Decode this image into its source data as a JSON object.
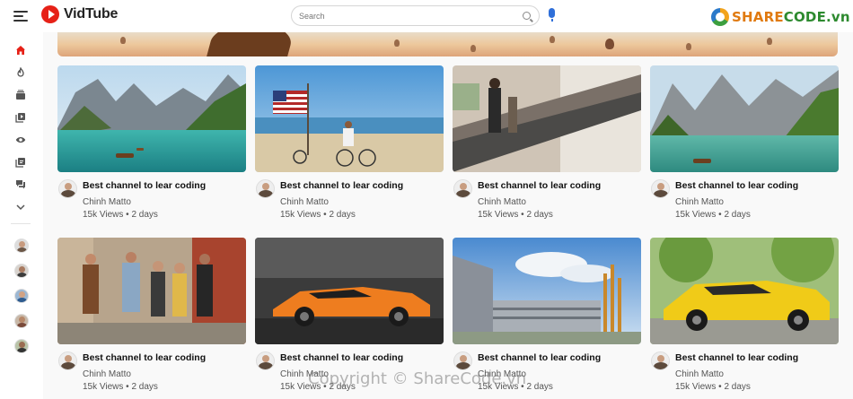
{
  "app": {
    "name": "VidTube"
  },
  "search": {
    "placeholder": "Search",
    "value": ""
  },
  "header": {
    "icons": [
      "upload-icon",
      "apps-icon",
      "bell-icon",
      "profile-avatar"
    ]
  },
  "sidebar": {
    "items": [
      {
        "icon": "home-icon",
        "color": "#e62117"
      },
      {
        "icon": "trending-icon"
      },
      {
        "icon": "subscriptions-icon"
      },
      {
        "icon": "library-icon"
      },
      {
        "icon": "history-icon"
      },
      {
        "icon": "playlist-icon"
      },
      {
        "icon": "messages-icon"
      },
      {
        "icon": "chevron-down-icon"
      }
    ],
    "subscriptions": 5
  },
  "videos": [
    {
      "title": "Best channel to lear coding",
      "channel": "Chinh Matto",
      "meta": "15k Views • 2 days",
      "thumbnail": "mountain-lake"
    },
    {
      "title": "Best channel to lear coding",
      "channel": "Chinh Matto",
      "meta": "15k Views • 2 days",
      "thumbnail": "beach-flag-bikes"
    },
    {
      "title": "Best channel to lear coding",
      "channel": "Chinh Matto",
      "meta": "15k Views • 2 days",
      "thumbnail": "escalator"
    },
    {
      "title": "Best channel to lear coding",
      "channel": "Chinh Matto",
      "meta": "15k Views • 2 days",
      "thumbnail": "mountain-lake-2"
    },
    {
      "title": "Best channel to lear coding",
      "channel": "Chinh Matto",
      "meta": "15k Views • 2 days",
      "thumbnail": "friends-walking"
    },
    {
      "title": "Best channel to lear coding",
      "channel": "Chinh Matto",
      "meta": "15k Views • 2 days",
      "thumbnail": "orange-sports-car"
    },
    {
      "title": "Best channel to lear coding",
      "channel": "Chinh Matto",
      "meta": "15k Views • 2 days",
      "thumbnail": "university-building"
    },
    {
      "title": "Best channel to lear coding",
      "channel": "Chinh Matto",
      "meta": "15k Views • 2 days",
      "thumbnail": "yellow-sports-car"
    }
  ],
  "watermarks": {
    "logo_text_a": "SHARE",
    "logo_text_b": "CODE",
    "logo_text_c": ".vn",
    "copyright": "Copyright © ShareCode.vn"
  },
  "colors": {
    "brand": "#e62117",
    "accent": "#2f6fd9"
  }
}
